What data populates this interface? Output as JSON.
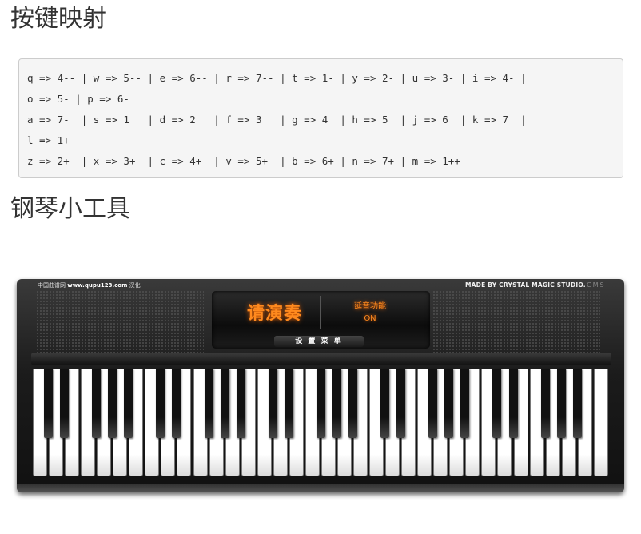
{
  "page": {
    "title_mapping": "按键映射",
    "title_piano": "钢琴小工具"
  },
  "mapping": {
    "lines": [
      "q => 4-- | w => 5-- | e => 6-- | r => 7-- | t => 1- | y => 2- | u => 3- | i => 4- |",
      "o => 5- | p => 6-",
      "a => 7-  | s => 1   | d => 2   | f => 3   | g => 4  | h => 5  | j => 6  | k => 7  |",
      "l => 1+",
      "z => 2+  | x => 3+  | c => 4+  | v => 5+  | b => 6+ | n => 7+ | m => 1++"
    ]
  },
  "piano": {
    "credit_left_prefix": "中国曲谱网",
    "credit_left_site": "www.qupu123.com",
    "credit_left_suffix": "汉化",
    "credit_right": "MADE BY CRYSTAL MAGIC STUDIO.",
    "studio_logo": "CMS",
    "display_main": "请演奏",
    "sustain_label": "延音功能",
    "sustain_state": "ON",
    "menu_button": "设 置 菜 单",
    "white_key_count": 36,
    "colors": {
      "accent": "#ff8a1e",
      "body": "#1b1b1b"
    }
  }
}
